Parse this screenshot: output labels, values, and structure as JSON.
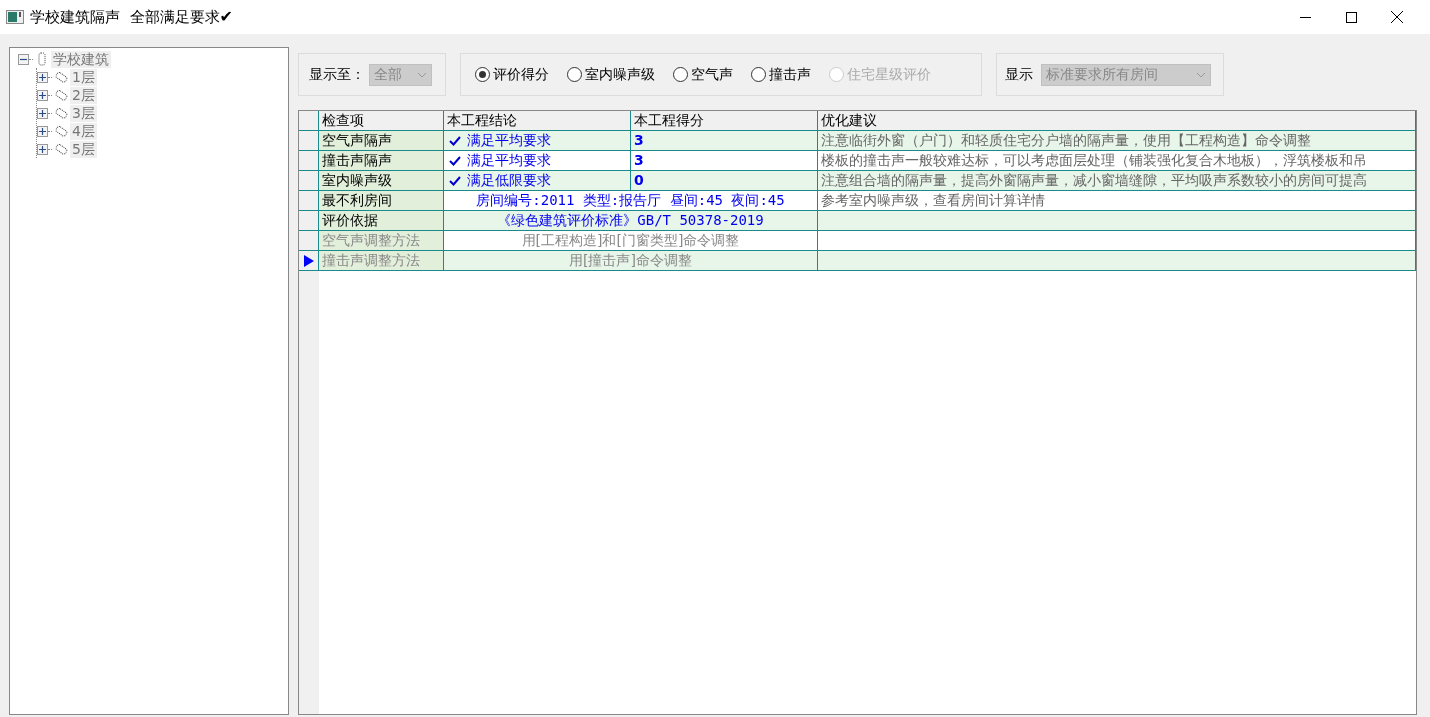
{
  "window": {
    "title": "学校建筑隔声  全部满足要求",
    "title_mark": "✔"
  },
  "tree": {
    "label": "学校建筑",
    "expanded": true,
    "children": [
      {
        "label": "1层",
        "expanded": false
      },
      {
        "label": "2层",
        "expanded": false
      },
      {
        "label": "3层",
        "expanded": false
      },
      {
        "label": "4层",
        "expanded": false
      },
      {
        "label": "5层",
        "expanded": false
      }
    ]
  },
  "display_to": {
    "label": "显示至：",
    "value": "全部"
  },
  "modes": [
    {
      "label": "评价得分",
      "selected": true,
      "disabled": false
    },
    {
      "label": "室内噪声级",
      "selected": false,
      "disabled": false
    },
    {
      "label": "空气声",
      "selected": false,
      "disabled": false
    },
    {
      "label": "撞击声",
      "selected": false,
      "disabled": false
    },
    {
      "label": "住宅星级评价",
      "selected": false,
      "disabled": true
    }
  ],
  "display": {
    "label": "显示",
    "value": "标准要求所有房间"
  },
  "table": {
    "columns": [
      "检查项",
      "本工程结论",
      "本工程得分",
      "优化建议"
    ],
    "rows": [
      {
        "kind": "result",
        "item": "空气声隔声",
        "conclusion": "满足平均要求",
        "score": "3",
        "advice": "注意临街外窗（户门）和轻质住宅分户墙的隔声量，使用【工程构造】命令调整",
        "dimmed": false,
        "current": false
      },
      {
        "kind": "result",
        "item": "撞击声隔声",
        "conclusion": "满足平均要求",
        "score": "3",
        "advice": "楼板的撞击声一般较难达标，可以考虑面层处理（铺装强化复合木地板），浮筑楼板和吊",
        "dimmed": false,
        "current": false
      },
      {
        "kind": "result",
        "item": "室内噪声级",
        "conclusion": "满足低限要求",
        "score": "0",
        "advice": "注意组合墙的隔声量，提高外窗隔声量，减小窗墙缝隙，平均吸声系数较小的房间可提高",
        "dimmed": false,
        "current": false
      },
      {
        "kind": "merged",
        "item": "最不利房间",
        "text": "房间编号:2011 类型:报告厅 昼间:45 夜间:45",
        "advice": "参考室内噪声级，查看房间计算详情",
        "dimmed": false,
        "current": false
      },
      {
        "kind": "merged",
        "item": "评价依据",
        "text": "《绿色建筑评价标准》GB/T 50378-2019",
        "dimmed": false,
        "current": false
      },
      {
        "kind": "merged",
        "item": "空气声调整方法",
        "text": "用[工程构造]和[门窗类型]命令调整",
        "dimmed": true,
        "current": false
      },
      {
        "kind": "merged",
        "item": "撞击声调整方法",
        "text": "用[撞击声]命令调整",
        "dimmed": true,
        "current": true
      }
    ]
  }
}
